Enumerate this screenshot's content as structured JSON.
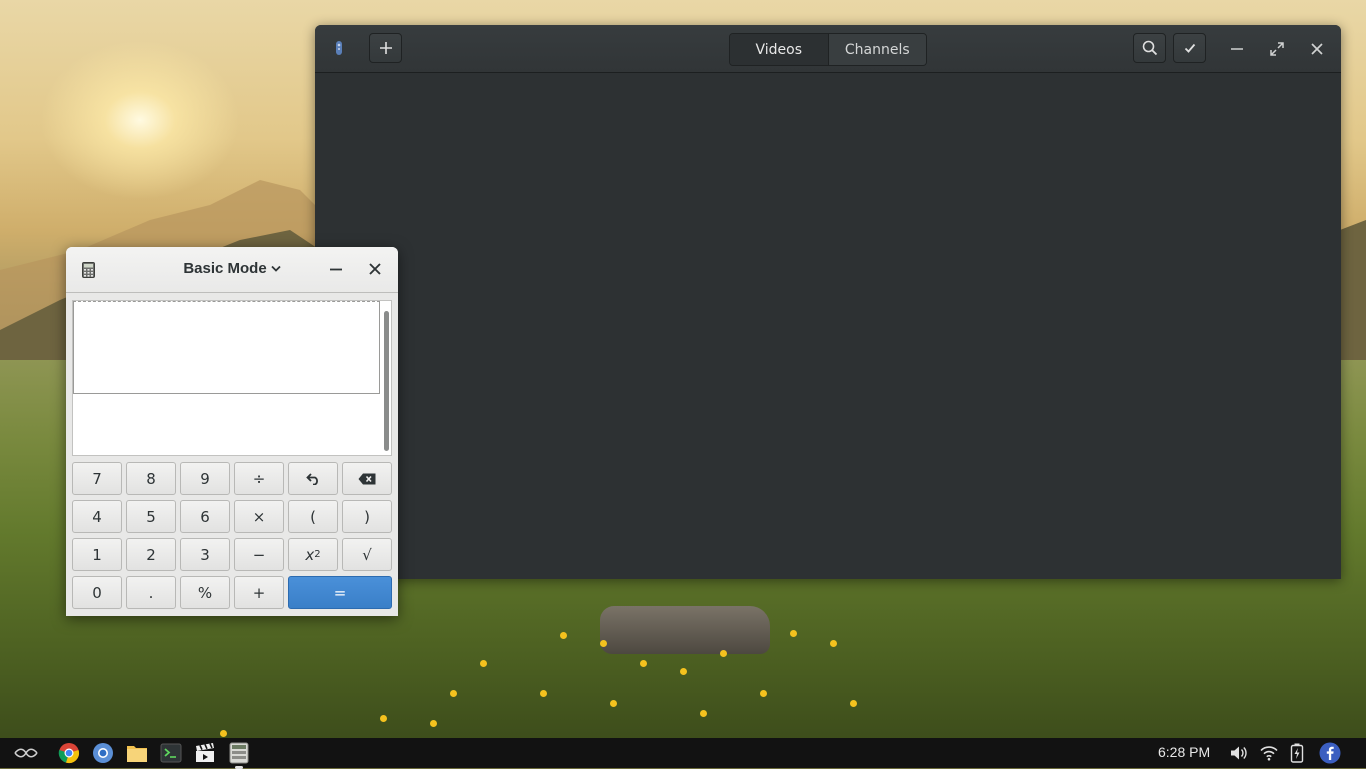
{
  "video_app": {
    "tabs": [
      {
        "label": "Videos"
      },
      {
        "label": "Channels"
      }
    ]
  },
  "calculator": {
    "mode_label": "Basic Mode",
    "keypad": {
      "rows": [
        [
          "7",
          "8",
          "9",
          "÷",
          "undo",
          "backspace"
        ],
        [
          "4",
          "5",
          "6",
          "×",
          "(",
          ")"
        ],
        [
          "1",
          "2",
          "3",
          "−",
          "x²",
          "√"
        ],
        [
          "0",
          ".",
          "%",
          "+",
          "="
        ]
      ]
    },
    "labels": {
      "k7": "7",
      "k8": "8",
      "k9": "9",
      "div": "÷",
      "k4": "4",
      "k5": "5",
      "k6": "6",
      "mul": "×",
      "lparen": "(",
      "rparen": ")",
      "k1": "1",
      "k2": "2",
      "k3": "3",
      "minus": "−",
      "sqrt": "√",
      "k0": "0",
      "dot": ".",
      "pct": "%",
      "plus": "+",
      "eq": "=",
      "sq_base": "x",
      "sq_exp": "2"
    }
  },
  "taskbar": {
    "clock": "6:28 PM"
  }
}
